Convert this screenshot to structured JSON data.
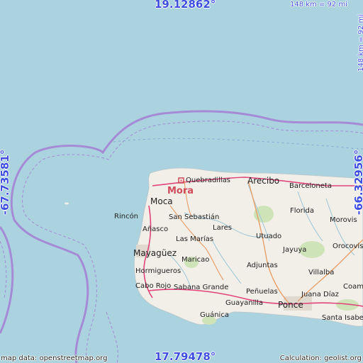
{
  "map": {
    "colors": {
      "water": "#aad3df",
      "land": "#f2efe9",
      "boundary": "#a58bd6",
      "road": "#e8a06a",
      "highway": "#e0457a",
      "marker": "#d04a5a"
    },
    "marker_name": "Mora",
    "places": {
      "quebradillas": "Quebradillas",
      "arecibo": "Arecibo",
      "barceloneta": "Barceloneta",
      "moca": "Moca",
      "rincon": "Rincón",
      "san_sebastian": "San Sebastián",
      "florida": "Florida",
      "morovis": "Morovis",
      "anasco": "Añasco",
      "lares": "Lares",
      "utuado": "Utuado",
      "las_marias": "Las Marías",
      "orocovis": "Orocovis",
      "jayuya": "Jayuya",
      "mayaguez": "Mayagüez",
      "maricao": "Maricao",
      "adjuntas": "Adjuntas",
      "hormigueros": "Hormigueros",
      "villalba": "Villalba",
      "cabo_rojo": "Cabo Rojo",
      "sabana_grande": "Sabana Grande",
      "coamo": "Coam",
      "penuelas": "Peñuelas",
      "juana_diaz": "Juana Díaz",
      "guayanilla": "Guayanilla",
      "ponce": "Ponce",
      "guanica": "Guánica",
      "santa_isabel": "Santa Isabel"
    }
  },
  "coords": {
    "north": "19.12862°",
    "south": "17.79478°",
    "west": "-67.73581°",
    "east": "-66.32956°"
  },
  "scale": {
    "horizontal": "148 km = 92 mi",
    "vertical": "148 km = 92 mi"
  },
  "credits": {
    "left": "map data: openstreetmap.org",
    "right": "Calculation: geolist.org"
  }
}
